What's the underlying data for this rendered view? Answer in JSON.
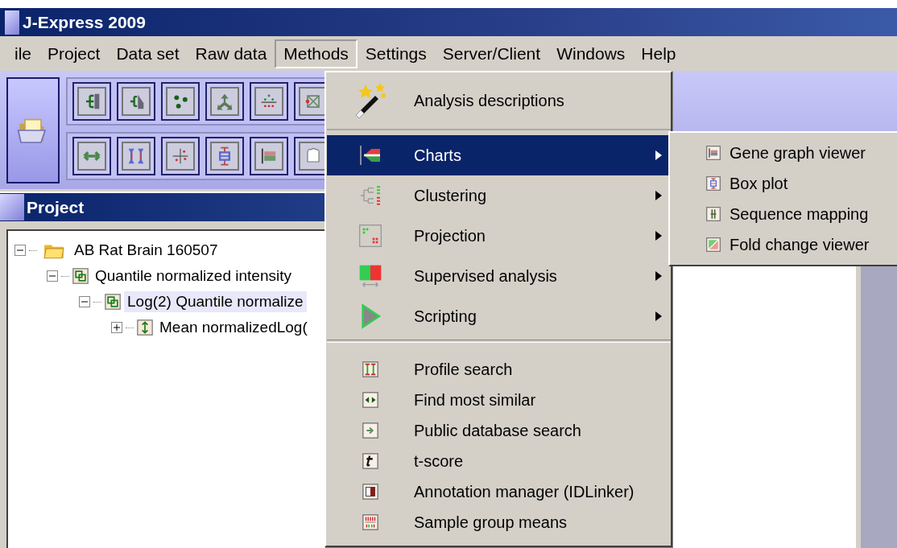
{
  "window": {
    "title": "J-Express 2009"
  },
  "menubar": [
    {
      "label": "ile",
      "selected": false
    },
    {
      "label": "Project",
      "selected": false
    },
    {
      "label": "Data set",
      "selected": false
    },
    {
      "label": "Raw data",
      "selected": false
    },
    {
      "label": "Methods",
      "selected": true
    },
    {
      "label": "Settings",
      "selected": false
    },
    {
      "label": "Server/Client",
      "selected": false
    },
    {
      "label": "Windows",
      "selected": false
    },
    {
      "label": "Help",
      "selected": false
    }
  ],
  "project_panel": {
    "title": "Project",
    "tree": [
      {
        "label": "AB Rat Brain 160507",
        "kind": "folder",
        "expanded": true,
        "selected": false,
        "children": [
          {
            "label": "Quantile normalized intensity",
            "kind": "dataset",
            "expanded": true,
            "selected": false,
            "children": [
              {
                "label": "Log(2) Quantile normalize",
                "kind": "dataset",
                "expanded": true,
                "selected": true,
                "children": [
                  {
                    "label": "Mean normalizedLog(",
                    "kind": "mean",
                    "expanded": false,
                    "selected": false
                  }
                ]
              }
            ]
          }
        ]
      }
    ]
  },
  "methods_menu": {
    "items": [
      {
        "label": "Analysis descriptions",
        "kind": "action",
        "selected": false
      },
      {
        "label": "Charts",
        "kind": "submenu",
        "selected": true
      },
      {
        "label": "Clustering",
        "kind": "submenu",
        "selected": false
      },
      {
        "label": "Projection",
        "kind": "submenu",
        "selected": false
      },
      {
        "label": "Supervised analysis",
        "kind": "submenu",
        "selected": false
      },
      {
        "label": "Scripting",
        "kind": "submenu",
        "selected": false
      },
      {
        "kind": "separator"
      },
      {
        "label": "Profile search",
        "kind": "action",
        "selected": false
      },
      {
        "label": "Find most similar",
        "kind": "action",
        "selected": false
      },
      {
        "label": "Public database search",
        "kind": "action",
        "selected": false
      },
      {
        "label": "t-score",
        "kind": "action",
        "selected": false
      },
      {
        "label": "Annotation manager (IDLinker)",
        "kind": "action",
        "selected": false
      },
      {
        "label": "Sample group means",
        "kind": "action",
        "selected": false
      }
    ]
  },
  "charts_submenu": {
    "items": [
      {
        "label": "Gene graph viewer",
        "selected": false
      },
      {
        "label": "Box plot",
        "selected": false
      },
      {
        "label": "Sequence mapping",
        "selected": false
      },
      {
        "label": "Fold change viewer",
        "selected": false
      }
    ]
  }
}
